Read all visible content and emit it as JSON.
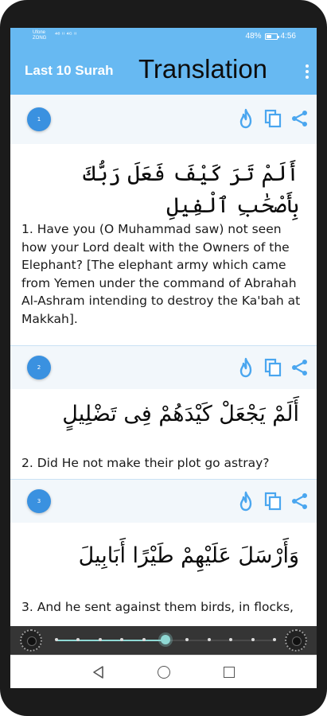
{
  "status_bar": {
    "carrier_line1": "Ufone",
    "carrier_line2": "ZONG",
    "signal_text": "⁴⁶ ᴵᴵ ⁴ᴳ ᴵᴵ",
    "battery_percent": "48%",
    "battery_level": 0.48,
    "time": "4:56"
  },
  "app_bar": {
    "title": "Last 10 Surah",
    "subtitle": "Translation",
    "menu_icon": "more-vert-icon"
  },
  "verses": [
    {
      "number": "1",
      "arabic": "أَلَمْ تَرَ كَيْفَ فَعَلَ رَبُّكَ بِأَصْحَٰبِ ٱلْفِيلِ",
      "translation": "1. Have you (O Muhammad saw) not seen how your Lord dealt with the Owners of the Elephant? [The elephant army which came from Yemen under the command of Abrahah Al-Ashram intending to destroy the Ka'bah at Makkah]."
    },
    {
      "number": "2",
      "arabic": "أَلَمْ يَجْعَلْ كَيْدَهُمْ فِى تَضْلِيلٍ",
      "translation": "2. Did He not make their plot go astray?"
    },
    {
      "number": "3",
      "arabic": "وَأَرْسَلَ عَلَيْهِمْ طَيْرًا أَبَابِيلَ",
      "translation": "3. And he sent against them birds, in flocks,"
    }
  ],
  "action_icons": [
    "fire-icon",
    "copy-icon",
    "share-icon"
  ],
  "player": {
    "progress": 0.5,
    "step_count": 11,
    "current_step": 5
  },
  "colors": {
    "primary": "#67b9f2",
    "accent_badge": "#3a91e0",
    "action_icon": "#4aa6ef",
    "player_progress": "#8fd8d4"
  }
}
